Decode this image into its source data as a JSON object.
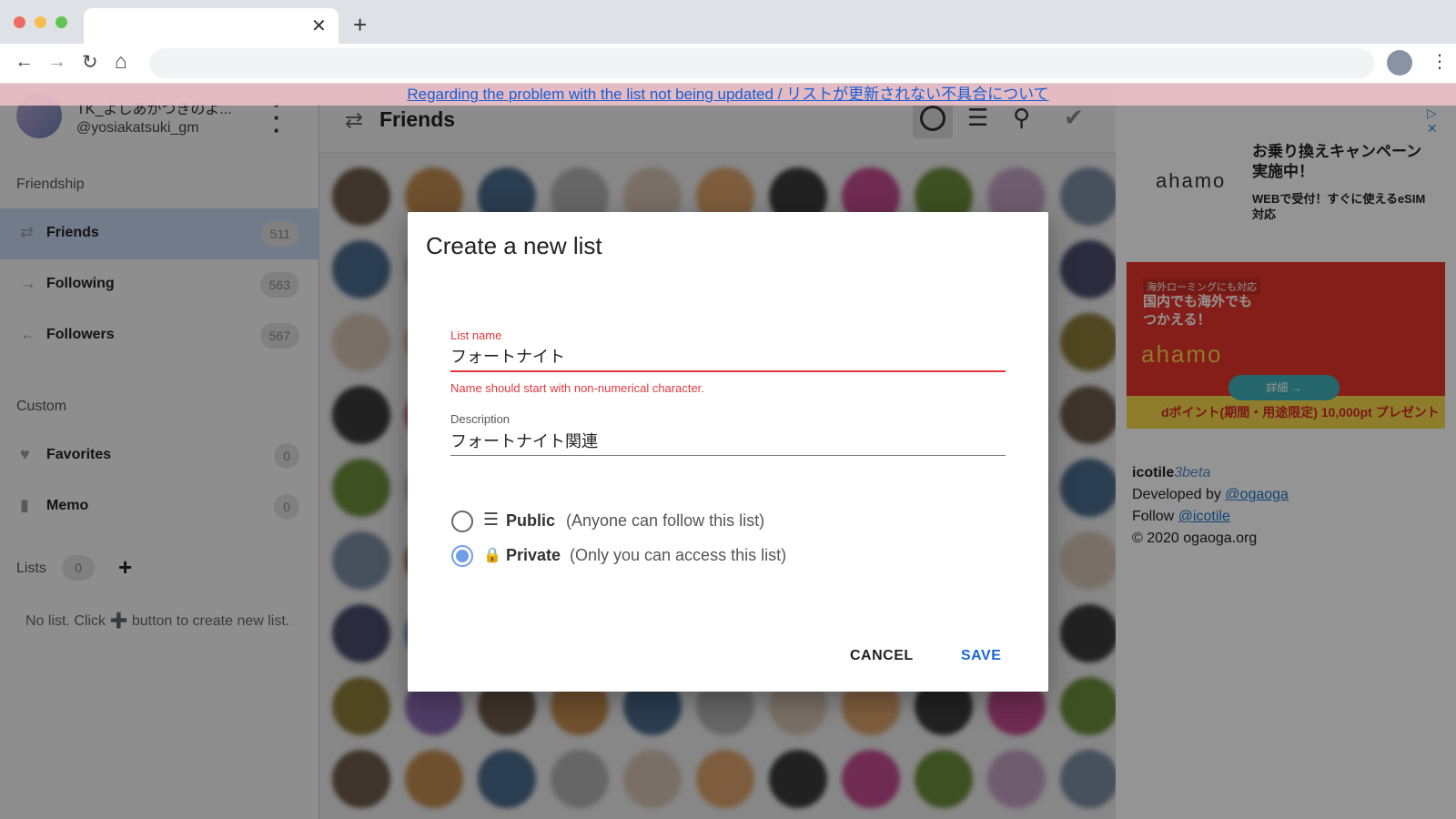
{
  "browser": {
    "tab_close": "✕",
    "new_tab": "+",
    "nav": {
      "back": "←",
      "forward": "→",
      "reload": "↻",
      "home": "⌂",
      "menu": "⋮"
    },
    "traffic_colors": [
      "#ee6a5e",
      "#f5bd4f",
      "#61c554"
    ]
  },
  "notice": {
    "text": "Regarding the problem with the list not being updated / リストが更新されない不具合について"
  },
  "sidebar": {
    "user": {
      "name": "TK_よしあかつきのよ...",
      "handle": "@yosiakatsuki_gm"
    },
    "friendship_title": "Friendship",
    "friendship_items": [
      {
        "label": "Friends",
        "count": "511",
        "icon": "⇄"
      },
      {
        "label": "Following",
        "count": "563",
        "icon": "→"
      },
      {
        "label": "Followers",
        "count": "567",
        "icon": "←"
      }
    ],
    "custom_title": "Custom",
    "custom_items": [
      {
        "label": "Favorites",
        "count": "0",
        "icon": "♥"
      },
      {
        "label": "Memo",
        "count": "0",
        "icon": "▮"
      }
    ],
    "lists": {
      "label": "Lists",
      "count": "0",
      "add": "+"
    },
    "empty_note": "No list. Click ➕ button to create new list."
  },
  "main": {
    "title": "Friends",
    "title_icon": "⇄"
  },
  "aside": {
    "ad": {
      "logo": "ahamo",
      "headline": "お乗り換えキャンペーン実施中！",
      "sub": "WEBで受付！すぐに使えるeSIM対応",
      "banner_tag": "海外ローミングにも対応",
      "banner_text": "国内でも海外でもつかえる！",
      "banner_logo": "ahamo",
      "banner_btn": "詳細 →",
      "banner_bottom": "dポイント(期間・用途限定) 10,000pt プレゼント",
      "choice": "▷ ✕"
    },
    "info": {
      "brand": "icotile",
      "version": "3",
      "beta": "beta",
      "developed_by": "Developed by ",
      "dev_link": "@ogaoga",
      "follow": "Follow ",
      "follow_link": "@icotile",
      "copyright": "© 2020 ogaoga.org"
    }
  },
  "dialog": {
    "title": "Create a new list",
    "list_name": {
      "label": "List name",
      "value": "フォートナイト",
      "error": "Name should start with non-numerical character."
    },
    "description": {
      "label": "Description",
      "value": "フォートナイト関連"
    },
    "visibility": [
      {
        "label": "Public",
        "desc": "(Anyone can follow this list)",
        "icon": "☰",
        "checked": false
      },
      {
        "label": "Private",
        "desc": "(Only you can access this list)",
        "icon": "🔒",
        "checked": true
      }
    ],
    "cancel_label": "CANCEL",
    "save_label": "SAVE"
  }
}
